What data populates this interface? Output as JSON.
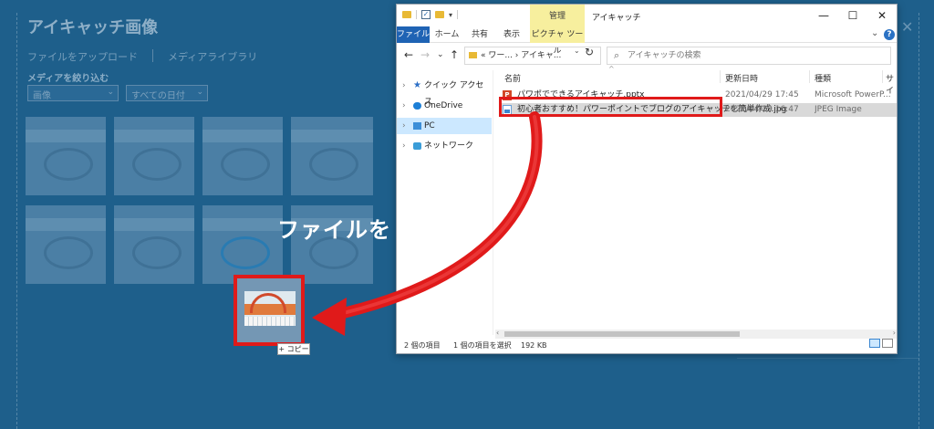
{
  "wp_modal": {
    "title": "アイキャッチ画像",
    "tabs": [
      "ファイルをアップロード",
      "メディアライブラリ"
    ],
    "filter_label": "メディアを絞り込む",
    "filter_type": "画像",
    "filter_date": "すべての日付"
  },
  "overlay": {
    "instruction": "ファイルを",
    "copy_badge": "+ コピー"
  },
  "explorer": {
    "manage_tab": "管理",
    "title": "アイキャッチ",
    "window_controls": {
      "minimize": "—",
      "maximize": "☐",
      "close": "✕"
    },
    "ribbon_tabs": [
      "ファイル",
      "ホーム",
      "共有",
      "表示",
      "ピクチャ ツール"
    ],
    "address": "« ワー... › アイキャ...",
    "search_placeholder": "アイキャッチの検索",
    "sidebar": [
      {
        "label": "クイック アクセス",
        "icon": "star-icon"
      },
      {
        "label": "OneDrive",
        "icon": "cloud-icon"
      },
      {
        "label": "PC",
        "icon": "pc-icon",
        "selected": true
      },
      {
        "label": "ネットワーク",
        "icon": "network-icon"
      }
    ],
    "columns": [
      "名前",
      "更新日時",
      "種類",
      "サイ"
    ],
    "files": [
      {
        "name": "パワポでできるアイキャッチ.pptx",
        "date": "2021/04/29 17:45",
        "type": "Microsoft PowerP...",
        "icon": "pptx-file-icon"
      },
      {
        "name": "初心者おすすめ！パワーポイントでブログのアイキャッチを簡単作成.jpg",
        "date": "2021/04/29 16:47",
        "type": "JPEG Image",
        "icon": "jpg-file-icon",
        "selected": true
      }
    ],
    "status": {
      "items": "2 個の項目",
      "selected": "1 個の項目を選択",
      "size": "192 KB"
    }
  },
  "colors": {
    "highlight": "#e01a1a",
    "file_tab": "#1f63b4",
    "context_tab": "#f7ef9e",
    "wp_overlay": "#1e5f8b"
  }
}
